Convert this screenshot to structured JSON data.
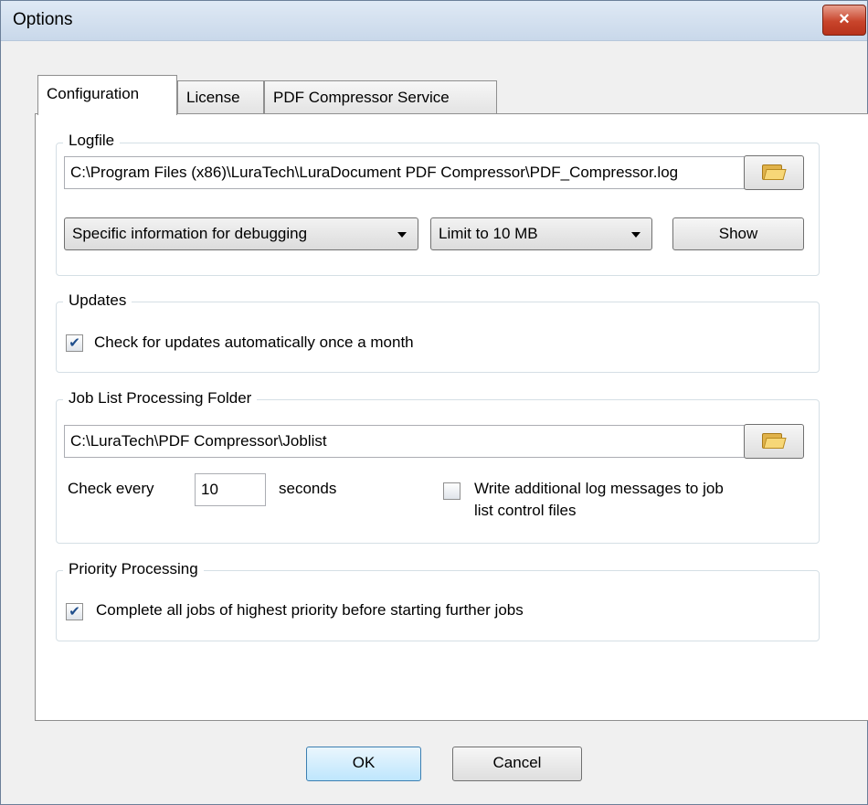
{
  "window": {
    "title": "Options",
    "close_glyph": "×"
  },
  "tabs": [
    {
      "label": "Configuration"
    },
    {
      "label": "License"
    },
    {
      "label": "PDF Compressor Service"
    }
  ],
  "logfile": {
    "legend": "Logfile",
    "path": "C:\\Program Files (x86)\\LuraTech\\LuraDocument PDF Compressor\\PDF_Compressor.log",
    "level_selected": "Specific information for debugging",
    "limit_selected": "Limit to 10 MB",
    "show_label": "Show"
  },
  "updates": {
    "legend": "Updates",
    "check_label": "Check for updates automatically once a month",
    "checked": true
  },
  "joblist": {
    "legend": "Job List Processing Folder",
    "path": "C:\\LuraTech\\PDF Compressor\\Joblist",
    "check_every_label": "Check every",
    "interval_value": "10",
    "seconds_label": "seconds",
    "write_log_label_line1": "Write additional log messages to job",
    "write_log_label_line2": "list control files",
    "write_log_checked": false
  },
  "priority": {
    "legend": "Priority Processing",
    "complete_label": "Complete all jobs of highest priority before starting further jobs",
    "checked": true
  },
  "footer": {
    "ok_label": "OK",
    "cancel_label": "Cancel"
  },
  "icons": {
    "browse": "folder-open-icon",
    "close": "close-icon"
  }
}
